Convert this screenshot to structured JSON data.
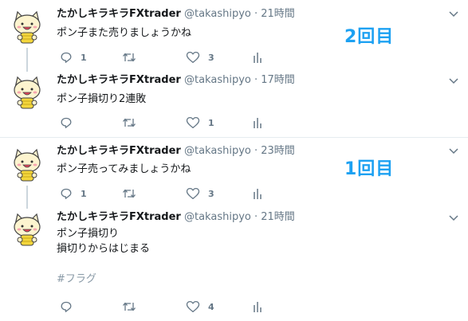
{
  "colors": {
    "accent": "#1da1f2",
    "text": "#14171a",
    "muted": "#657786",
    "hashtag": "#8899a6",
    "divider": "#e6ecf0"
  },
  "annotations": {
    "second": "2回目",
    "first": "1回目"
  },
  "tweets": [
    {
      "name": "たかしキラキラFXtrader",
      "handle": "@takashipyo",
      "dot": "·",
      "time": "21時間",
      "lines": [
        "ポン子また売りましょうかね"
      ],
      "hashtag": "",
      "reply_count": "1",
      "retweet_count": "",
      "like_count": "3",
      "icons": [
        "reply-icon",
        "retweet-icon",
        "heart-icon",
        "analytics-icon"
      ]
    },
    {
      "name": "たかしキラキラFXtrader",
      "handle": "@takashipyo",
      "dot": "·",
      "time": "17時間",
      "lines": [
        "ポン子損切り2連敗"
      ],
      "hashtag": "",
      "reply_count": "",
      "retweet_count": "",
      "like_count": "1",
      "icons": [
        "reply-icon",
        "retweet-icon",
        "heart-icon",
        "analytics-icon"
      ]
    },
    {
      "name": "たかしキラキラFXtrader",
      "handle": "@takashipyo",
      "dot": "·",
      "time": "23時間",
      "lines": [
        "ポン子売ってみましょうかね"
      ],
      "hashtag": "",
      "reply_count": "1",
      "retweet_count": "",
      "like_count": "3",
      "icons": [
        "reply-icon",
        "retweet-icon",
        "heart-icon",
        "analytics-icon"
      ]
    },
    {
      "name": "たかしキラキラFXtrader",
      "handle": "@takashipyo",
      "dot": "·",
      "time": "21時間",
      "lines": [
        "ポン子損切り",
        "損切りからはじまる"
      ],
      "hashtag": "#フラグ",
      "reply_count": "",
      "retweet_count": "",
      "like_count": "4",
      "icons": [
        "reply-icon",
        "retweet-icon",
        "heart-icon",
        "analytics-icon"
      ]
    }
  ]
}
